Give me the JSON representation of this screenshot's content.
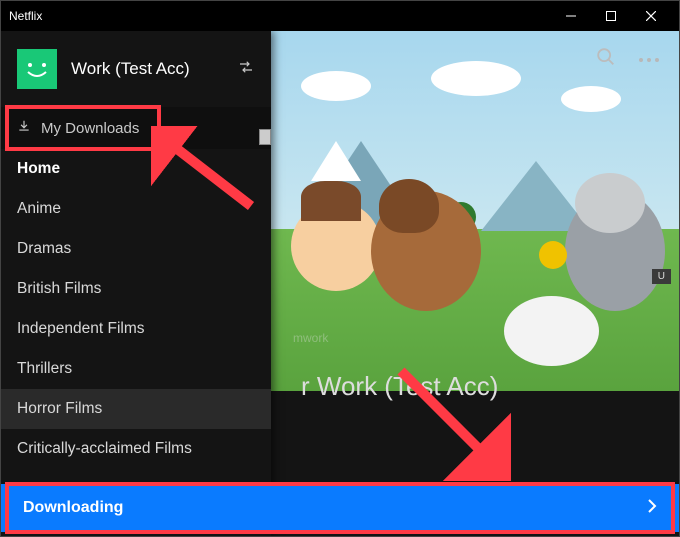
{
  "titlebar": {
    "app_name": "Netflix"
  },
  "profile": {
    "name": "Work (Test Acc)"
  },
  "my_downloads": {
    "label": "My Downloads"
  },
  "sidebar": {
    "items": [
      {
        "label": "Home",
        "active": true
      },
      {
        "label": "Anime"
      },
      {
        "label": "Dramas"
      },
      {
        "label": "British Films"
      },
      {
        "label": "Independent Films"
      },
      {
        "label": "Thrillers"
      },
      {
        "label": "Horror Films",
        "hover": true
      },
      {
        "label": "Critically-acclaimed Films"
      }
    ]
  },
  "hero": {
    "greeting_fragment": "r Work (Test Acc)",
    "teamwork_fragment": "mwork"
  },
  "rating_badge": "U",
  "bottombar": {
    "status": "Downloading"
  },
  "colors": {
    "accent_blue": "#0a7bff",
    "avatar_green": "#19c877",
    "annotation_red": "#ff3a45"
  }
}
